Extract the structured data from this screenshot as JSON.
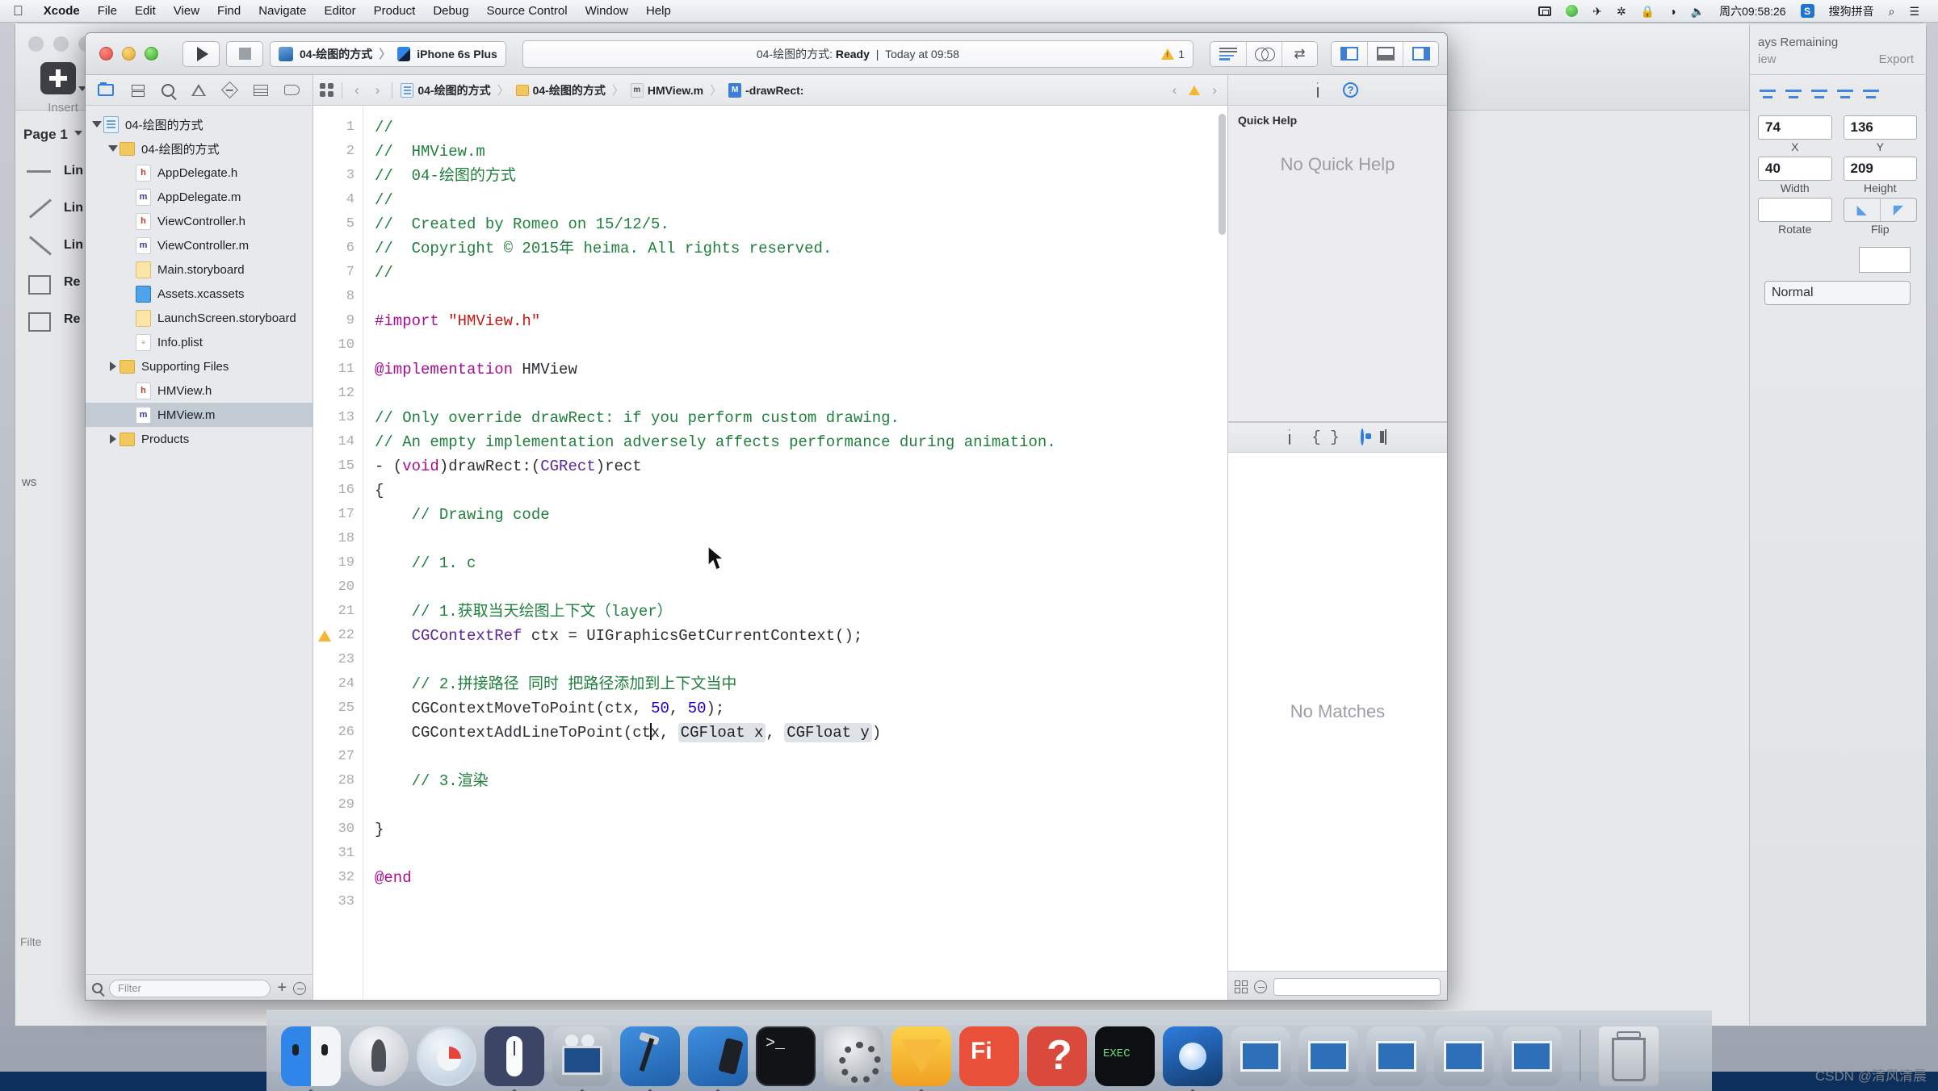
{
  "menubar": {
    "apple": "",
    "items": [
      {
        "label": "Xcode",
        "bold": true
      },
      {
        "label": "File"
      },
      {
        "label": "Edit"
      },
      {
        "label": "View"
      },
      {
        "label": "Find"
      },
      {
        "label": "Navigate"
      },
      {
        "label": "Editor"
      },
      {
        "label": "Product"
      },
      {
        "label": "Debug"
      },
      {
        "label": "Source Control"
      },
      {
        "label": "Window"
      },
      {
        "label": "Help"
      }
    ],
    "status_items": [
      {
        "name": "screen-record-icon"
      },
      {
        "name": "play-status-icon"
      },
      {
        "name": "airplane-icon",
        "glyph": "✈"
      },
      {
        "name": "bluetooth-icon",
        "glyph": "✲"
      },
      {
        "name": "lock-icon",
        "glyph": "🔒"
      },
      {
        "name": "wifi-icon",
        "glyph": "◥"
      },
      {
        "name": "volume-icon",
        "glyph": "◀))"
      }
    ],
    "clock": "周六09:58:26",
    "input_method_badge": "S",
    "input_method": "搜狗拼音",
    "search_glyph": "⌕",
    "list_glyph": "☰"
  },
  "xcode": {
    "toolbar": {
      "run_title": "Run",
      "stop_title": "Stop",
      "scheme_name": "04-绘图的方式",
      "scheme_separator": "〉",
      "destination": "iPhone 6s Plus",
      "status_project": "04-绘图的方式:",
      "status_state": "Ready",
      "status_divider": "|",
      "status_time": "Today at 09:58",
      "warning_count": "1",
      "editor_modes": [
        "standard-editor",
        "assistant-editor",
        "version-editor"
      ],
      "view_toggles": [
        "navigator-toggle",
        "debug-area-toggle",
        "utilities-toggle"
      ]
    },
    "navigator": {
      "tabs": [
        "project-navigator",
        "source-control-navigator",
        "find-navigator",
        "issue-navigator",
        "test-navigator",
        "debug-navigator",
        "breakpoint-navigator"
      ],
      "tree": [
        {
          "label": "04-绘图的方式",
          "indent": 0,
          "disc": "down",
          "icon": "proj",
          "selected": false
        },
        {
          "label": "04-绘图的方式",
          "indent": 1,
          "disc": "down",
          "icon": "fold",
          "selected": false
        },
        {
          "label": "AppDelegate.h",
          "indent": 2,
          "disc": "",
          "icon": "h",
          "selected": false
        },
        {
          "label": "AppDelegate.m",
          "indent": 2,
          "disc": "",
          "icon": "m",
          "selected": false
        },
        {
          "label": "ViewController.h",
          "indent": 2,
          "disc": "",
          "icon": "h",
          "selected": false
        },
        {
          "label": "ViewController.m",
          "indent": 2,
          "disc": "",
          "icon": "m",
          "selected": false
        },
        {
          "label": "Main.storyboard",
          "indent": 2,
          "disc": "",
          "icon": "sb",
          "selected": false
        },
        {
          "label": "Assets.xcassets",
          "indent": 2,
          "disc": "",
          "icon": "xca",
          "selected": false
        },
        {
          "label": "LaunchScreen.storyboard",
          "indent": 2,
          "disc": "",
          "icon": "sb",
          "selected": false
        },
        {
          "label": "Info.plist",
          "indent": 2,
          "disc": "",
          "icon": "plist",
          "selected": false
        },
        {
          "label": "Supporting Files",
          "indent": 1,
          "disc": "right",
          "icon": "fold",
          "selected": false
        },
        {
          "label": "HMView.h",
          "indent": 2,
          "disc": "",
          "icon": "h",
          "selected": false
        },
        {
          "label": "HMView.m",
          "indent": 2,
          "disc": "",
          "icon": "m",
          "selected": true
        },
        {
          "label": "Products",
          "indent": 1,
          "disc": "right",
          "icon": "fold",
          "selected": false
        }
      ],
      "filter_placeholder": "Filter",
      "add_label": "+"
    },
    "jumpbar": {
      "crumbs": [
        {
          "label": "04-绘图的方式",
          "icon": "proj"
        },
        {
          "label": "04-绘图的方式",
          "icon": "fold"
        },
        {
          "label": "HMView.m",
          "icon": "m"
        },
        {
          "label": "-drawRect:",
          "icon": "M"
        }
      ],
      "separator": "〉"
    },
    "code": {
      "filename": "HMView.m",
      "warning_line": 22,
      "lines": [
        {
          "n": 1,
          "tokens": [
            {
              "t": "//",
              "c": "cmt"
            }
          ]
        },
        {
          "n": 2,
          "tokens": [
            {
              "t": "//  HMView.m",
              "c": "cmt"
            }
          ]
        },
        {
          "n": 3,
          "tokens": [
            {
              "t": "//  04-绘图的方式",
              "c": "cmt"
            }
          ]
        },
        {
          "n": 4,
          "tokens": [
            {
              "t": "//",
              "c": "cmt"
            }
          ]
        },
        {
          "n": 5,
          "tokens": [
            {
              "t": "//  Created by Romeo on 15/12/5.",
              "c": "cmt"
            }
          ]
        },
        {
          "n": 6,
          "tokens": [
            {
              "t": "//  Copyright © 2015年 heima. All rights reserved.",
              "c": "cmt"
            }
          ]
        },
        {
          "n": 7,
          "tokens": [
            {
              "t": "//",
              "c": "cmt"
            }
          ]
        },
        {
          "n": 8,
          "tokens": []
        },
        {
          "n": 9,
          "tokens": [
            {
              "t": "#import ",
              "c": "kw"
            },
            {
              "t": "\"HMView.h\"",
              "c": "str"
            }
          ]
        },
        {
          "n": 10,
          "tokens": []
        },
        {
          "n": 11,
          "tokens": [
            {
              "t": "@implementation",
              "c": "kw"
            },
            {
              "t": " HMView",
              "c": "fn"
            }
          ]
        },
        {
          "n": 12,
          "tokens": []
        },
        {
          "n": 13,
          "tokens": [
            {
              "t": "// Only override drawRect: if you perform custom drawing.",
              "c": "cmt"
            }
          ]
        },
        {
          "n": 14,
          "tokens": [
            {
              "t": "// An empty implementation adversely affects performance during animation.",
              "c": "cmt"
            }
          ]
        },
        {
          "n": 15,
          "tokens": [
            {
              "t": "- (",
              "c": "fn"
            },
            {
              "t": "void",
              "c": "kw"
            },
            {
              "t": ")drawRect:(",
              "c": "fn"
            },
            {
              "t": "CGRect",
              "c": "typ"
            },
            {
              "t": ")rect",
              "c": "fn"
            }
          ]
        },
        {
          "n": 16,
          "tokens": [
            {
              "t": "{",
              "c": "fn"
            }
          ]
        },
        {
          "n": 17,
          "tokens": [
            {
              "t": "    // Drawing code",
              "c": "cmt"
            }
          ]
        },
        {
          "n": 18,
          "tokens": []
        },
        {
          "n": 19,
          "tokens": [
            {
              "t": "    // 1. c",
              "c": "cmt"
            }
          ]
        },
        {
          "n": 20,
          "tokens": []
        },
        {
          "n": 21,
          "tokens": [
            {
              "t": "    // 1.获取当天绘图上下文（layer）",
              "c": "cmt"
            }
          ]
        },
        {
          "n": 22,
          "tokens": [
            {
              "t": "    ",
              "c": "fn"
            },
            {
              "t": "CGContextRef",
              "c": "typ"
            },
            {
              "t": " ctx = UIGraphicsGetCurrentContext();",
              "c": "fn"
            }
          ]
        },
        {
          "n": 23,
          "tokens": []
        },
        {
          "n": 24,
          "tokens": [
            {
              "t": "    // 2.拼接路径 同时 把路径添加到上下文当中",
              "c": "cmt"
            }
          ]
        },
        {
          "n": 25,
          "tokens": [
            {
              "t": "    CGContextMoveToPoint(ctx, ",
              "c": "fn"
            },
            {
              "t": "50",
              "c": "num"
            },
            {
              "t": ", ",
              "c": "fn"
            },
            {
              "t": "50",
              "c": "num"
            },
            {
              "t": ");",
              "c": "fn"
            }
          ]
        },
        {
          "n": 26,
          "tokens": [
            {
              "t": "    CGContextAddLineToPoint(ct",
              "c": "fn"
            },
            {
              "t": "|caret|",
              "c": "caret"
            },
            {
              "t": "x, ",
              "c": "fn"
            },
            {
              "t": "CGFloat x",
              "c": "ph"
            },
            {
              "t": ", ",
              "c": "fn"
            },
            {
              "t": "CGFloat y",
              "c": "ph"
            },
            {
              "t": ")",
              "c": "fn"
            }
          ]
        },
        {
          "n": 27,
          "tokens": []
        },
        {
          "n": 28,
          "tokens": [
            {
              "t": "    // 3.渲染",
              "c": "cmt"
            }
          ]
        },
        {
          "n": 29,
          "tokens": []
        },
        {
          "n": 30,
          "tokens": [
            {
              "t": "}",
              "c": "fn"
            }
          ]
        },
        {
          "n": 31,
          "tokens": []
        },
        {
          "n": 32,
          "tokens": [
            {
              "t": "@end",
              "c": "kw"
            }
          ]
        },
        {
          "n": 33,
          "tokens": []
        }
      ]
    },
    "utilities": {
      "tabs": [
        "file-inspector",
        "quick-help-inspector"
      ],
      "quick_help_title": "Quick Help",
      "quick_help_empty": "No Quick Help",
      "library_tabs": [
        "file-template-library",
        "code-snippet-library",
        "object-library",
        "media-library"
      ],
      "library_empty": "No Matches",
      "library_search_placeholder": ""
    }
  },
  "background_app": {
    "insert_label": "Insert",
    "page_label": "Page 1",
    "shapes": [
      {
        "label": "Lin",
        "shape": "l1"
      },
      {
        "label": "Lin",
        "shape": "l2"
      },
      {
        "label": "Lin",
        "shape": "l3"
      },
      {
        "label": "Re",
        "shape": "rc"
      },
      {
        "label": "Re",
        "shape": "rc"
      }
    ],
    "filter_label": "Filte",
    "remaining_label": "ays Remaining",
    "view_label": "iew",
    "export_label": "Export",
    "inspector": {
      "x_value": "74",
      "x_label": "X",
      "y_value": "136",
      "y_label": "Y",
      "width_value": "40",
      "width_label": "Width",
      "height_value": "209",
      "height_label": "Height",
      "rotate_value": "",
      "rotate_label": "Rotate",
      "flip_label": "Flip",
      "blend_mode": "Normal"
    },
    "views_label": "ws"
  },
  "dock": {
    "items": [
      {
        "name": "finder",
        "cls": "d-finder",
        "running": true
      },
      {
        "name": "launchpad",
        "cls": "d-launch",
        "running": false
      },
      {
        "name": "safari",
        "cls": "d-safari",
        "running": false
      },
      {
        "name": "mou",
        "cls": "d-mouse",
        "running": true
      },
      {
        "name": "quicktime",
        "cls": "d-qt",
        "running": true
      },
      {
        "name": "xcode",
        "cls": "d-xcode",
        "running": true
      },
      {
        "name": "interface-builder",
        "cls": "d-ib",
        "running": true
      },
      {
        "name": "terminal",
        "cls": "d-term",
        "running": false
      },
      {
        "name": "system-preferences",
        "cls": "d-prefs",
        "running": false
      },
      {
        "name": "sketch",
        "cls": "d-sketch",
        "running": true
      },
      {
        "name": "fireworks",
        "cls": "d-ps",
        "running": false
      },
      {
        "name": "question-app",
        "cls": "d-q",
        "running": false
      },
      {
        "name": "exec-app",
        "cls": "d-exec",
        "running": false
      },
      {
        "name": "media-player",
        "cls": "d-media",
        "running": true
      },
      {
        "name": "window-app-1",
        "cls": "d-win",
        "running": false
      },
      {
        "name": "window-app-2",
        "cls": "d-win",
        "running": false
      },
      {
        "name": "window-app-3",
        "cls": "d-win",
        "running": false
      },
      {
        "name": "window-app-4",
        "cls": "d-win",
        "running": false
      },
      {
        "name": "window-app-5",
        "cls": "d-win",
        "running": false
      }
    ],
    "trash_name": "trash"
  },
  "watermark": "CSDN @清风清晨"
}
